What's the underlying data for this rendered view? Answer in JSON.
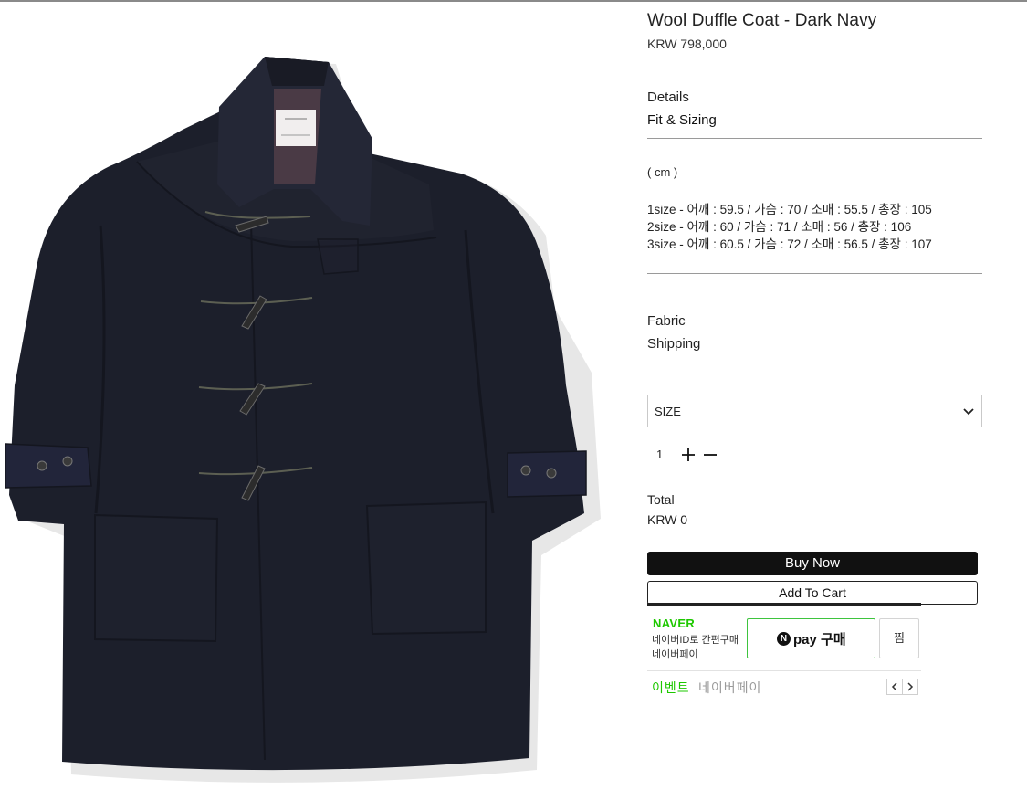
{
  "product": {
    "title": "Wool Duffle Coat - Dark Navy",
    "price": "KRW 798,000",
    "image_alt": "Navy wool duffle coat with toggle closures"
  },
  "tabs": {
    "details": "Details",
    "fit_sizing": "Fit & Sizing",
    "fabric": "Fabric",
    "shipping": "Shipping"
  },
  "sizing": {
    "unit": "( cm )",
    "rows": [
      "1size - 어깨 : 59.5 / 가슴 : 70 / 소매 : 55.5 / 총장 : 105",
      "2size - 어깨 : 60 / 가슴 : 71 / 소매 : 56 / 총장 : 106",
      "3size - 어깨 : 60.5 / 가슴 : 72 / 소매 : 56.5 / 총장 : 107"
    ]
  },
  "options": {
    "size_select_label": "SIZE",
    "quantity": "1"
  },
  "total": {
    "label": "Total",
    "value": "KRW 0"
  },
  "actions": {
    "buy_now": "Buy Now",
    "add_to_cart": "Add To Cart"
  },
  "naver_pay": {
    "logo": "NAVER",
    "desc_line1": "네이버ID로 간편구매",
    "desc_line2": "네이버페이",
    "pay_button_n": "N",
    "pay_button_text": "pay 구매",
    "zzim": "찜",
    "event_label": "이벤트",
    "event_text": "네이버페이"
  },
  "colors": {
    "accent_naver": "#1ec800",
    "coat": "#1c1f2b",
    "buy_button": "#111111"
  },
  "icons": {
    "size_dropdown": "chevron-down-icon",
    "qty_plus": "plus-icon",
    "qty_minus": "minus-icon",
    "event_prev": "chevron-left-icon",
    "event_next": "chevron-right-icon"
  }
}
